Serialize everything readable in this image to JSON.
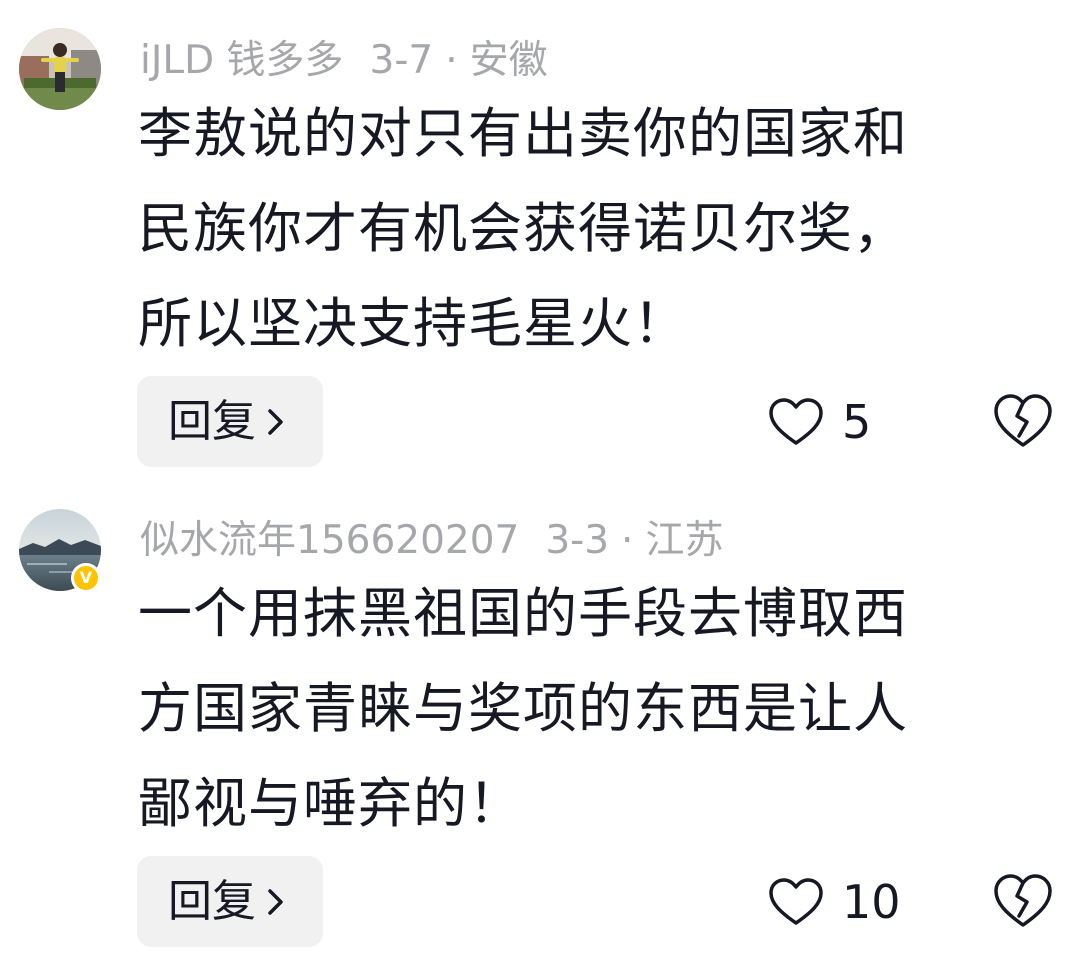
{
  "comments": [
    {
      "username": "iJLD 钱多多",
      "date": "3-7",
      "separator": "·",
      "location": "安徽",
      "text": "李敖说的对只有出卖你的国家和\n民族你才有机会获得诺贝尔奖，\n所以坚决支持毛星火！",
      "reply_label": "回复",
      "like_count": "5",
      "verified": false
    },
    {
      "username": "似水流年156620207",
      "date": "3-3",
      "separator": "·",
      "location": "江苏",
      "text": "一个用抹黑祖国的手段去博取西\n方国家青睐与奖项的东西是让人\n鄙视与唾弃的！",
      "reply_label": "回复",
      "like_count": "10",
      "verified": true,
      "badge_glyph": "V"
    }
  ],
  "icons": {
    "reply_chevron": "chevron-right-icon",
    "like": "heart-icon",
    "dislike": "broken-heart-icon"
  },
  "colors": {
    "meta_text": "#a6a7ab",
    "body_text": "#161823",
    "reply_bg": "#f1f1f2",
    "verified_badge": "#ffc300"
  }
}
